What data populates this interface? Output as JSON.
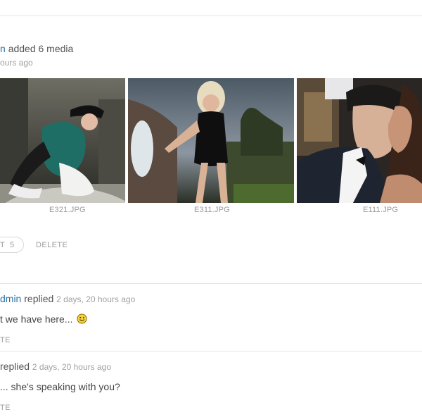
{
  "activity": {
    "actor_fragment": "n",
    "action_text": "added 6 media",
    "time_fragment": "ours ago"
  },
  "media": [
    {
      "filename": "E321.JPG"
    },
    {
      "filename": "E311.JPG"
    },
    {
      "filename": "E111.JPG"
    }
  ],
  "actions": {
    "comment_fragment": "T",
    "comment_count": "5",
    "delete_label": "DELETE"
  },
  "replies": [
    {
      "author_fragment": "dmin",
      "verb": "replied",
      "time": "2 days, 20 hours ago",
      "text_fragment": "t we have here...",
      "emoji": "smiley-face",
      "delete_fragment": "TE"
    },
    {
      "author_fragment": "",
      "verb": "replied",
      "time": "2 days, 20 hours ago",
      "text_fragment": "... she's speaking with you?",
      "delete_fragment": "TE"
    }
  ],
  "colors": {
    "link": "#2e72a8",
    "muted": "#9b9b9b",
    "divider": "#e6e6e6"
  }
}
